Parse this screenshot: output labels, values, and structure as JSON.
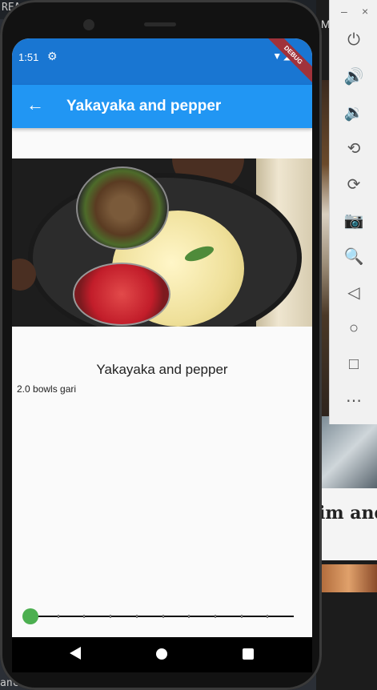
{
  "desktop": {
    "top_left_text": "REA",
    "top_right_text": "M",
    "bottom_text": "anch",
    "background_card_text": "im and"
  },
  "emulator_toolbar": {
    "buttons": [
      "power-icon",
      "volume-up-icon",
      "volume-down-icon",
      "rotate-left-icon",
      "rotate-right-icon",
      "camera-icon",
      "zoom-icon",
      "back-icon",
      "home-icon",
      "overview-icon",
      "more-icon"
    ],
    "minimize_label": "–",
    "close_label": "×"
  },
  "status_bar": {
    "time": "1:51",
    "icons": "▼◢▮",
    "debug_label": "DEBUG"
  },
  "app_bar": {
    "back_icon": "←",
    "title": "Yakayaka and pepper"
  },
  "recipe": {
    "name": "Yakayaka and pepper",
    "ingredients": [
      "2.0 bowls gari"
    ]
  },
  "slider": {
    "value": 0.0,
    "divisions": 10,
    "color": "#4caf50"
  },
  "colors": {
    "status_bar": "#1976d2",
    "app_bar": "#2196f3",
    "slider_thumb": "#4caf50"
  }
}
